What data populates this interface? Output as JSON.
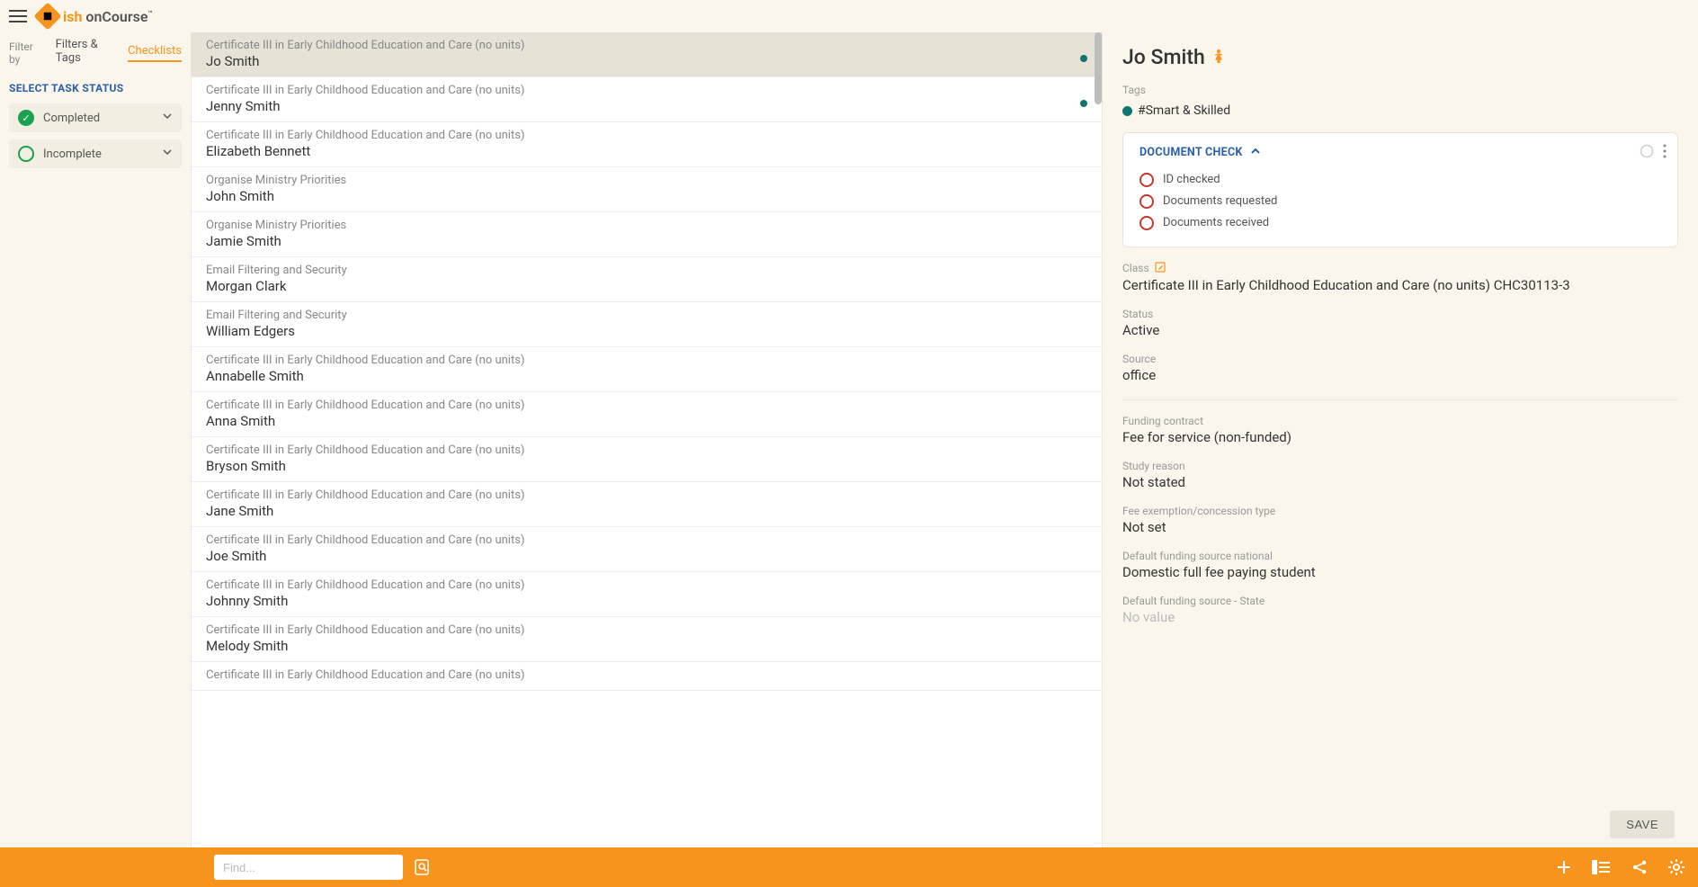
{
  "header": {
    "brand_left": "ish",
    "brand_right": "onCourse",
    "tm": "™"
  },
  "sidebar": {
    "filter_by": "Filter by",
    "tab_filters": "Filters & Tags",
    "tab_checklists": "Checklists",
    "section_title": "SELECT TASK STATUS",
    "status": [
      {
        "label": "Completed",
        "kind": "completed"
      },
      {
        "label": "Incomplete",
        "kind": "incomplete"
      }
    ]
  },
  "list": [
    {
      "course": "Certificate III in Early Childhood Education and Care (no units)",
      "person": "Jo Smith",
      "selected": true,
      "dot": true
    },
    {
      "course": "Certificate III in Early Childhood Education and Care (no units)",
      "person": "Jenny Smith",
      "selected": false,
      "dot": true
    },
    {
      "course": "Certificate III in Early Childhood Education and Care (no units)",
      "person": "Elizabeth Bennett",
      "selected": false,
      "dot": false
    },
    {
      "course": "Organise Ministry Priorities",
      "person": "John Smith",
      "selected": false,
      "dot": false
    },
    {
      "course": "Organise Ministry Priorities",
      "person": "Jamie Smith",
      "selected": false,
      "dot": false
    },
    {
      "course": "Email Filtering and Security",
      "person": "Morgan Clark",
      "selected": false,
      "dot": false
    },
    {
      "course": "Email Filtering and Security",
      "person": "William Edgers",
      "selected": false,
      "dot": false
    },
    {
      "course": "Certificate III in Early Childhood Education and Care (no units)",
      "person": "Annabelle Smith",
      "selected": false,
      "dot": false
    },
    {
      "course": "Certificate III in Early Childhood Education and Care (no units)",
      "person": "Anna Smith",
      "selected": false,
      "dot": false
    },
    {
      "course": "Certificate III in Early Childhood Education and Care (no units)",
      "person": "Bryson Smith",
      "selected": false,
      "dot": false
    },
    {
      "course": "Certificate III in Early Childhood Education and Care (no units)",
      "person": "Jane Smith",
      "selected": false,
      "dot": false
    },
    {
      "course": "Certificate III in Early Childhood Education and Care (no units)",
      "person": "Joe Smith",
      "selected": false,
      "dot": false
    },
    {
      "course": "Certificate III in Early Childhood Education and Care (no units)",
      "person": "Johnny Smith",
      "selected": false,
      "dot": false
    },
    {
      "course": "Certificate III in Early Childhood Education and Care (no units)",
      "person": "Melody Smith",
      "selected": false,
      "dot": false
    },
    {
      "course": "Certificate III in Early Childhood Education and Care (no units)",
      "person": "",
      "selected": false,
      "dot": false
    }
  ],
  "detail": {
    "name": "Jo Smith",
    "tags_label": "Tags",
    "tag": "#Smart & Skilled",
    "card_title": "DOCUMENT CHECK",
    "checks": [
      {
        "label": "ID checked"
      },
      {
        "label": "Documents requested"
      },
      {
        "label": "Documents received"
      }
    ],
    "fields": [
      {
        "label": "Class",
        "value": "Certificate III in Early Childhood Education and Care (no units) CHC30113-3",
        "edit": true
      },
      {
        "label": "Status",
        "value": "Active"
      },
      {
        "label": "Source",
        "value": "office"
      }
    ],
    "fields2": [
      {
        "label": "Funding contract",
        "value": "Fee for service (non-funded)"
      },
      {
        "label": "Study reason",
        "value": "Not stated"
      },
      {
        "label": "Fee exemption/concession type",
        "value": "Not set"
      },
      {
        "label": "Default funding source national",
        "value": "Domestic full fee paying student"
      },
      {
        "label": "Default funding source - State",
        "value": "No value",
        "muted": true
      }
    ],
    "save": "SAVE"
  },
  "bottombar": {
    "placeholder": "Find..."
  }
}
